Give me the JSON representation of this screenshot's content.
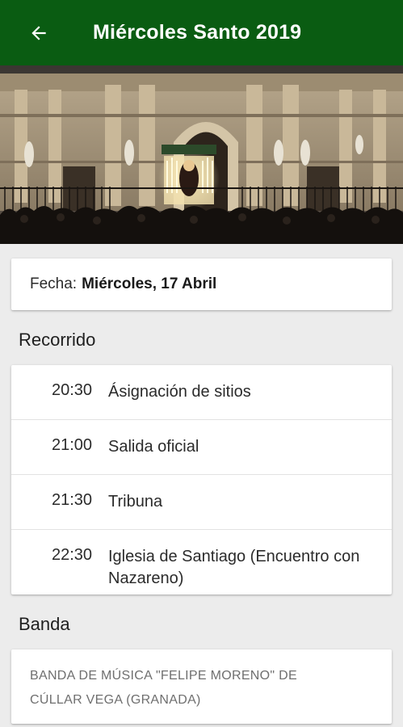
{
  "app_bar": {
    "title": "Miércoles Santo 2019",
    "back_icon": "arrow-left-icon",
    "background": "#0a5c12"
  },
  "date_card": {
    "label": "Fecha:",
    "value": "Miércoles, 17 Abril"
  },
  "route": {
    "title": "Recorrido",
    "items": [
      {
        "time": "20:30",
        "place": "Ásignación de sitios"
      },
      {
        "time": "21:00",
        "place": "Salida oficial"
      },
      {
        "time": "21:30",
        "place": "Tribuna"
      },
      {
        "time": "22:30",
        "place": "Iglesia de Santiago (Encuentro con Nazareno)"
      }
    ]
  },
  "band": {
    "title": "Banda",
    "text": "BANDA DE MÚSICA \"FELIPE MORENO\" DE CÚLLAR VEGA (GRANADA)"
  }
}
